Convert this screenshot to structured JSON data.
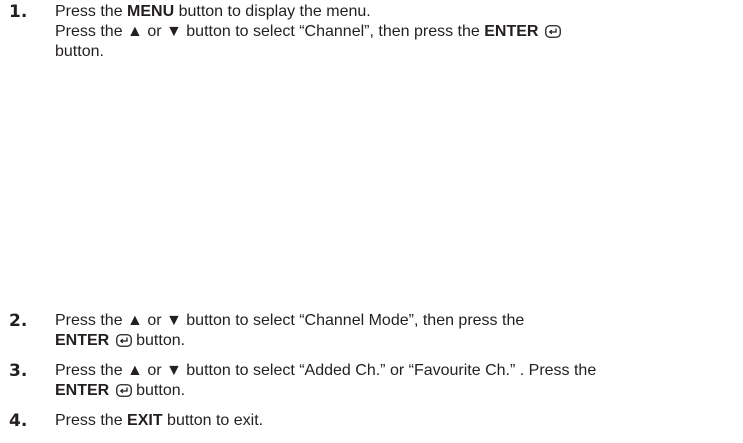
{
  "steps": [
    {
      "number": "1.",
      "line1_pre": "Press the ",
      "line1_bold": "MENU",
      "line1_post": " button to display the menu.",
      "line2_pre": "Press the ▲ or ▼ button to select “Channel”, then press the ",
      "line2_bold": "ENTER",
      "line2_post": " button."
    },
    {
      "number": "2.",
      "line1": "Press the ▲ or ▼ button to select “Channel Mode”, then press the",
      "line2_bold": "ENTER",
      "line2_post": " button."
    },
    {
      "number": "3.",
      "line1": "Press the ▲ or ▼ button to select “Added Ch.” or “Favourite Ch.” . Press the",
      "line2_bold": "ENTER",
      "line2_post": " button."
    },
    {
      "number": "4.",
      "text_pre": "Press the ",
      "text_bold": "EXIT",
      "text_post": " button to exit."
    }
  ],
  "icons": {
    "enter": "enter-icon"
  }
}
